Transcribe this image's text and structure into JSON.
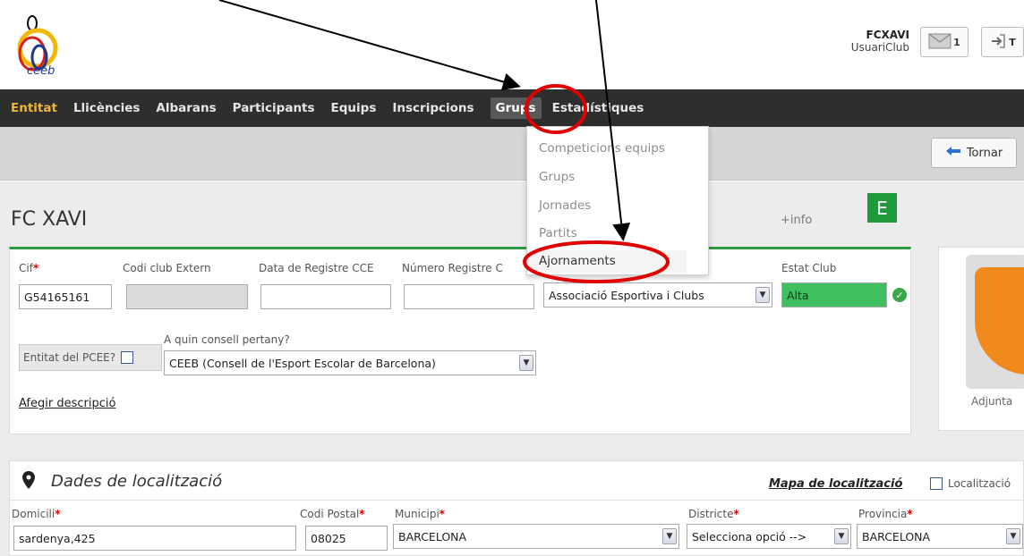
{
  "header": {
    "logo_text": "ceeb",
    "user_name": "FCXAVI",
    "user_role": "UsuariClub",
    "message_count": "1",
    "exit_label": "T"
  },
  "nav": {
    "items": [
      {
        "label": "Entitat"
      },
      {
        "label": "Llicències"
      },
      {
        "label": "Albarans"
      },
      {
        "label": "Participants"
      },
      {
        "label": "Equips"
      },
      {
        "label": "Inscripcions"
      },
      {
        "label": "Grups"
      },
      {
        "label": "Estadístiques"
      }
    ]
  },
  "dropdown": {
    "items": [
      {
        "label": "Competicions equips"
      },
      {
        "label": "Grups"
      },
      {
        "label": "Jornades"
      },
      {
        "label": "Partits"
      },
      {
        "label": "Ajornaments"
      }
    ]
  },
  "toolbar": {
    "back_label": "Tornar"
  },
  "entity": {
    "title": "FC XAVI",
    "info_link": "+info",
    "badge": "E",
    "fields": {
      "cif_label": "Cif",
      "cif_value": "G54165161",
      "codi_extern_label": "Codi club Extern",
      "data_registre_label": "Data de Registre CCE",
      "numero_registre_label": "Número Registre C",
      "tipus_value": "Associació Esportiva i Clubs",
      "estat_label": "Estat Club",
      "estat_value": "Alta",
      "pcee_label": "Entitat del PCEE?",
      "consell_label": "A quin consell pertany?",
      "consell_value": "CEEB (Consell de l'Esport Escolar de Barcelona)",
      "description_link": "Afegir descripció"
    },
    "image_card_label": "Adjunta"
  },
  "location": {
    "title": "Dades de localització",
    "map_link": "Mapa de localització",
    "checkbox_label": "Localització",
    "fields": {
      "domicili_label": "Domicili",
      "domicili_value": "sardenya,425",
      "codi_postal_label": "Codi Postal",
      "codi_postal_value": "08025",
      "municipi_label": "Municipi",
      "municipi_value": "BARCELONA",
      "districte_label": "Districte",
      "districte_value": "Selecciona opció -->",
      "provincia_label": "Provincia",
      "provincia_value": "BARCELONA"
    }
  },
  "colors": {
    "nav_bg": "#2e2e2e",
    "nav_active": "#f0b733",
    "accent_green": "#2e9d3f",
    "badge_green": "#1e9a3c",
    "annotation_red": "#e00000"
  },
  "icons": [
    "envelope-icon",
    "exit-icon",
    "back-arrow-icon",
    "check-circle-icon",
    "map-pin-icon",
    "chevron-down-icon"
  ]
}
